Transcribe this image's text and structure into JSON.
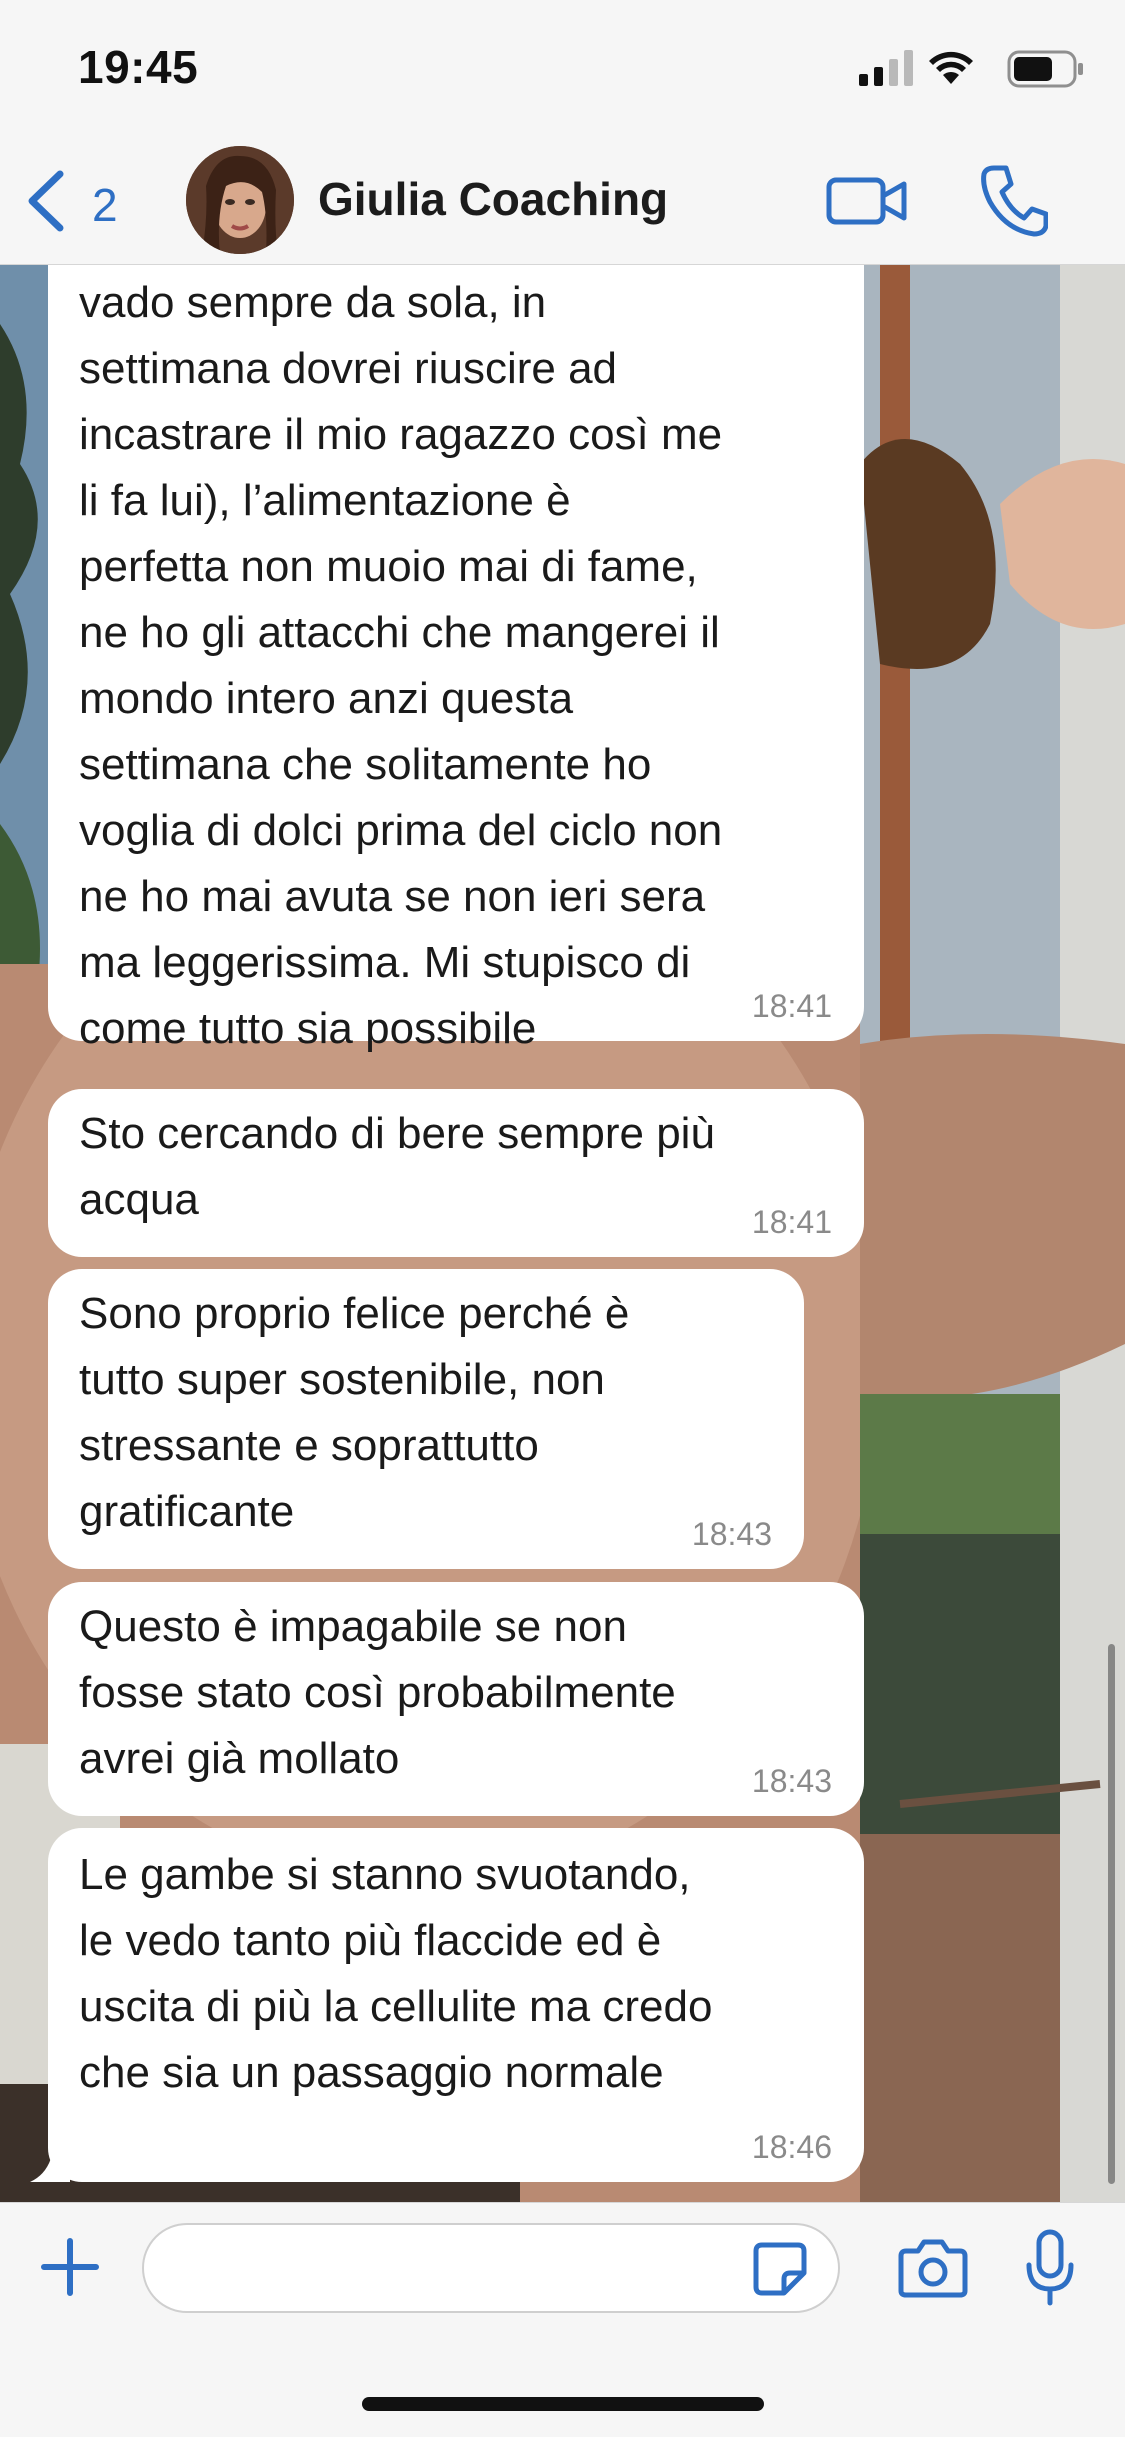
{
  "status_bar": {
    "time": "19:45",
    "icons": [
      "signal-icon",
      "wifi-icon",
      "battery-icon"
    ]
  },
  "header": {
    "back_count": "2",
    "contact_name": "Giulia Coaching",
    "icons": [
      "chevron-left-icon",
      "video-camera-icon",
      "phone-icon"
    ]
  },
  "messages": [
    {
      "text": "vado sempre da sola, in\nsettimana dovrei riuscire ad\nincastrare il mio ragazzo così me\nli fa lui), l’alimentazione è\nperfetta non muoio mai di fame,\nne ho gli attacchi che mangerei il\nmondo intero anzi questa\nsettimana che solitamente ho\nvoglia di dolci prima del ciclo non\nne ho mai avuta se non ieri sera\nma leggerissima. Mi stupisco di\ncome tutto sia possibile",
      "time": "18:41"
    },
    {
      "text": "Sto cercando di bere sempre più\nacqua",
      "time": "18:41"
    },
    {
      "text": "Sono proprio felice perché è\ntutto super sostenibile, non\nstressante e soprattutto\ngratificante",
      "time": "18:43"
    },
    {
      "text": "Questo è impagabile se non\nfosse stato così probabilmente\navrei già mollato",
      "time": "18:43"
    },
    {
      "text": "Le gambe si stanno svuotando,\nle vedo tanto più flaccide ed è\nuscita di più la cellulite ma credo\nche sia un passaggio normale",
      "time": "18:46"
    }
  ],
  "input_bar": {
    "message_value": "",
    "icons": [
      "plus-icon",
      "sticker-icon",
      "camera-icon",
      "microphone-icon"
    ]
  },
  "colors": {
    "accent": "#2e6fc4",
    "bubble": "#ffffff",
    "bar_background": "#f6f6f6",
    "timestamp": "#8a8a8a"
  }
}
